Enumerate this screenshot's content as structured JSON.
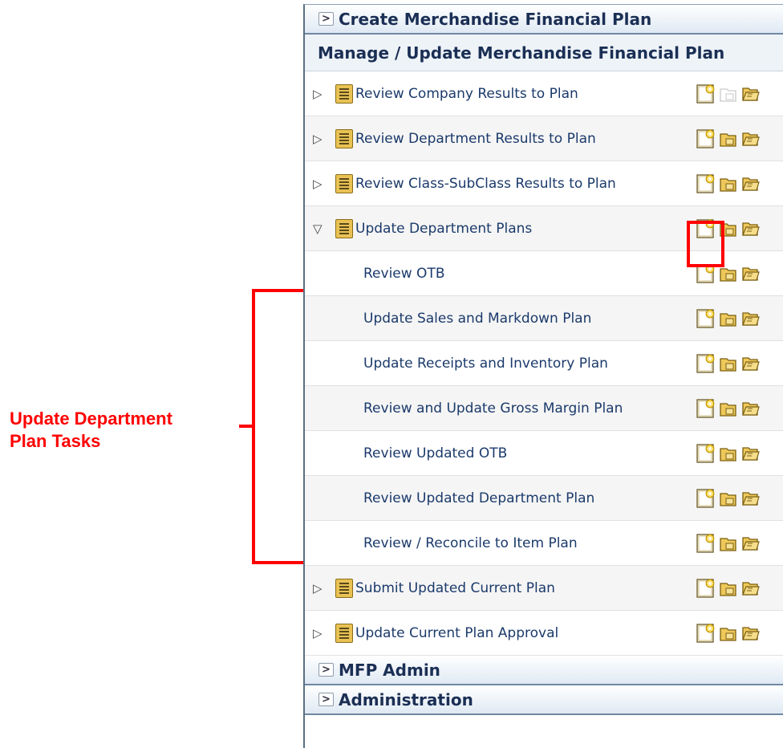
{
  "annotation": {
    "label_line1": "Update Department",
    "label_line2": "Plan Tasks"
  },
  "panel": {
    "create_header": "Create Merchandise Financial Plan",
    "manage_header": "Manage / Update Merchandise Financial Plan",
    "rows": [
      {
        "label": "Review Company Results to Plan",
        "type": "parent",
        "expanded": false,
        "view_enabled": false
      },
      {
        "label": "Review Department Results to Plan",
        "type": "parent",
        "expanded": false,
        "view_enabled": true
      },
      {
        "label": "Review Class-SubClass Results to Plan",
        "type": "parent",
        "expanded": false,
        "view_enabled": true
      },
      {
        "label": "Update Department Plans",
        "type": "parent",
        "expanded": true,
        "view_enabled": true
      },
      {
        "label": "Review OTB",
        "type": "child",
        "view_enabled": true
      },
      {
        "label": "Update Sales and Markdown Plan",
        "type": "child",
        "view_enabled": true
      },
      {
        "label": "Update Receipts and Inventory Plan",
        "type": "child",
        "view_enabled": true
      },
      {
        "label": "Review and Update Gross Margin Plan",
        "type": "child",
        "view_enabled": true
      },
      {
        "label": "Review Updated OTB",
        "type": "child",
        "view_enabled": true
      },
      {
        "label": "Review Updated Department Plan",
        "type": "child",
        "view_enabled": true
      },
      {
        "label": "Review / Reconcile to Item Plan",
        "type": "child",
        "view_enabled": true
      },
      {
        "label": "Submit Updated Current Plan",
        "type": "parent",
        "expanded": false,
        "view_enabled": true
      },
      {
        "label": "Update Current Plan Approval",
        "type": "parent",
        "expanded": false,
        "view_enabled": true
      }
    ],
    "mfp_admin_header": "MFP Admin",
    "administration_header": "Administration"
  },
  "icons": {
    "collapsed": "triangle-right-icon",
    "expanded": "triangle-down-icon",
    "task": "task-list-icon",
    "new": "new-workbook-icon",
    "view": "view-workbook-icon",
    "open": "open-workbook-icon"
  },
  "colors": {
    "annotation": "#ff0000",
    "link_text": "#1b3a6b",
    "header_text": "#1b2f55",
    "icon_gold": "#e9c254"
  }
}
